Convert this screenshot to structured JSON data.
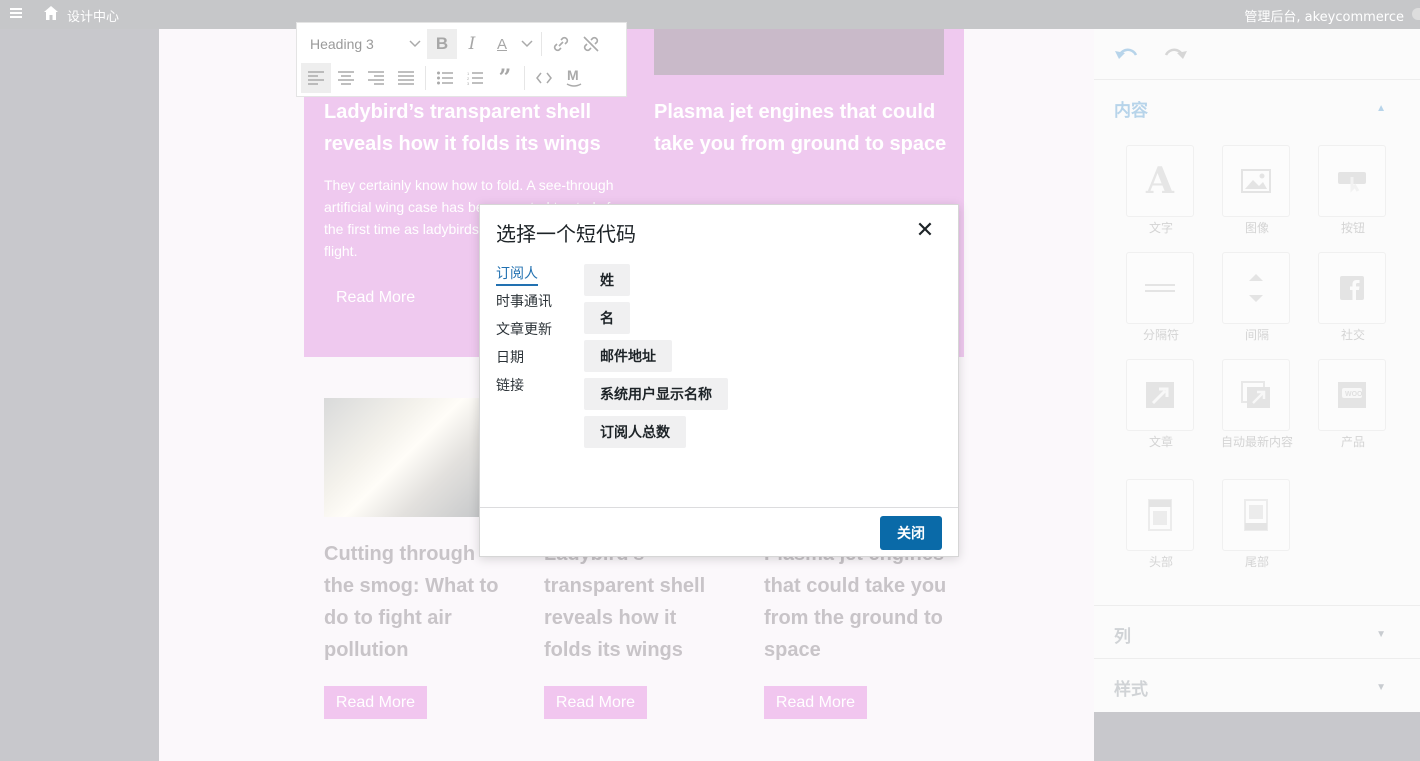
{
  "topbar": {
    "site_title": "设计中心",
    "account": "管理后台, akeycommerce"
  },
  "toolbar": {
    "heading_value": "Heading 3"
  },
  "canvas": {
    "top_cards": [
      {
        "title": "Ladybird’s transparent shell reveals how it folds its wings",
        "text": "They certainly know how to fold. A see-through artificial wing case has been created to study for the first time as ladybirds fold their wings after flight.",
        "button": "Read More"
      },
      {
        "title": "Plasma jet engines that could take you from ground to space"
      }
    ],
    "bottom_cards": [
      {
        "title": "Cutting through the smog: What to do to fight air pollution",
        "button": "Read More"
      },
      {
        "title": "Ladybird’s transparent shell reveals how it folds its wings",
        "button": "Read More"
      },
      {
        "title": "Plasma jet engines that could take you from the ground to space",
        "button": "Read More"
      }
    ]
  },
  "sidebar": {
    "content_heading": "内容",
    "blocks": [
      {
        "label": "文字",
        "icon": "text-icon"
      },
      {
        "label": "图像",
        "icon": "image-icon"
      },
      {
        "label": "按钮",
        "icon": "button-icon"
      },
      {
        "label": "分隔符",
        "icon": "divider-icon"
      },
      {
        "label": "间隔",
        "icon": "spacer-icon"
      },
      {
        "label": "社交",
        "icon": "facebook-icon"
      },
      {
        "label": "文章",
        "icon": "post-icon"
      },
      {
        "label": "自动最新内容",
        "icon": "auto-post-icon"
      },
      {
        "label": "产品",
        "icon": "woo-product-icon"
      },
      {
        "label": "头部",
        "icon": "header-icon"
      },
      {
        "label": "尾部",
        "icon": "footer-icon"
      }
    ],
    "columns_heading": "列",
    "styles_heading": "样式"
  },
  "modal": {
    "title": "选择一个短代码",
    "categories": [
      "订阅人",
      "时事通讯",
      "文章更新",
      "日期",
      "链接"
    ],
    "active_category": "订阅人",
    "shortcodes": [
      "姓",
      "名",
      "邮件地址",
      "系统用户显示名称",
      "订阅人总数"
    ],
    "close_button": "关闭"
  },
  "colors": {
    "accent": "#2271b1",
    "primary_button": "#0a6aa8",
    "pink": "#efc9ef"
  }
}
